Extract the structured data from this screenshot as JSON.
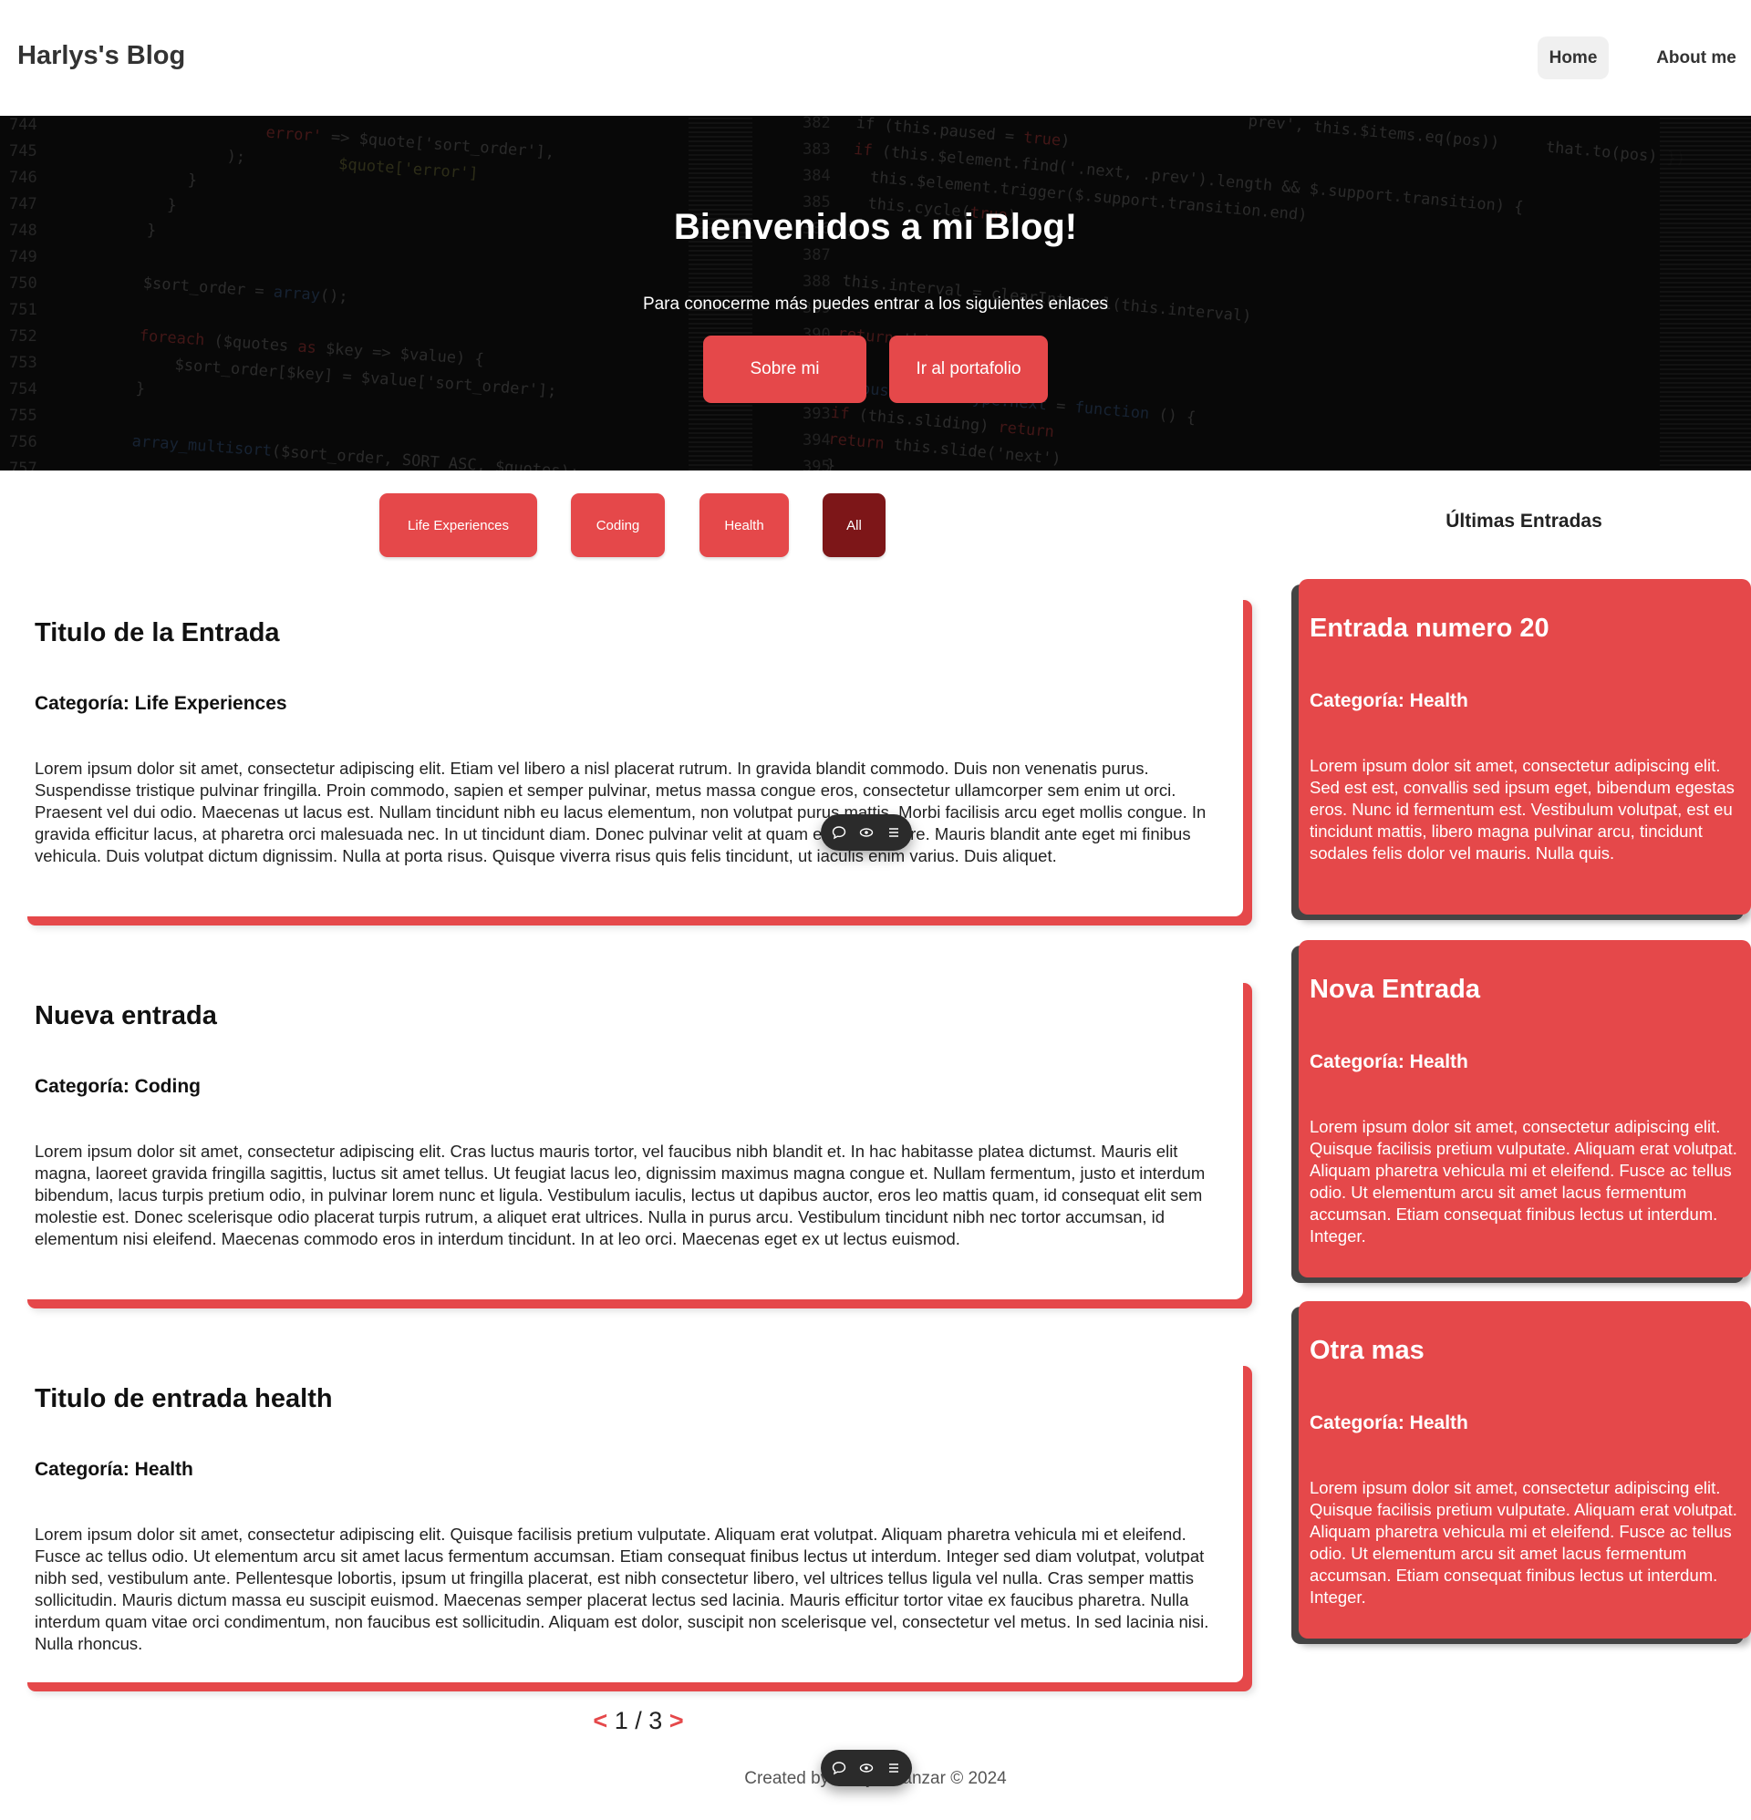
{
  "header": {
    "brand": "Harlys's Blog",
    "nav": [
      {
        "label": "Home",
        "active": true
      },
      {
        "label": "About me",
        "active": false
      }
    ]
  },
  "hero": {
    "title": "Bienvenidos a mi Blog!",
    "subtitle": "Para conocerme más puedes entrar a los siguientes enlaces",
    "buttons": [
      {
        "label": "Sobre mi"
      },
      {
        "label": "Ir al portafolio"
      }
    ]
  },
  "filters": [
    {
      "label": "Life Experiences",
      "active": false
    },
    {
      "label": "Coding",
      "active": false
    },
    {
      "label": "Health",
      "active": false
    },
    {
      "label": "All",
      "active": true
    }
  ],
  "posts": [
    {
      "title": "Titulo de la Entrada",
      "category": "Categoría: Life Experiences",
      "body": "Lorem ipsum dolor sit amet, consectetur adipiscing elit. Etiam vel libero a nisl placerat rutrum. In gravida blandit commodo. Duis non venenatis purus. Suspendisse tristique pulvinar fringilla. Proin commodo, sapien et semper pulvinar, metus massa congue eros, consectetur ullamcorper sem enim ut orci. Praesent vel dui odio. Maecenas ut lacus est. Nullam tincidunt nibh eu lacus elementum, non volutpat purus mattis. Morbi facilisis arcu eget mollis congue. In gravida efficitur lacus, at pharetra orci malesuada nec. In ut tincidunt diam. Donec pulvinar velit at quam eleifend ornare. Mauris blandit ante eget mi finibus vehicula. Duis volutpat dictum dignissim. Nulla at porta risus. Quisque viverra risus quis felis tincidunt, ut iaculis enim varius. Duis aliquet."
    },
    {
      "title": "Nueva entrada",
      "category": "Categoría: Coding",
      "body": "Lorem ipsum dolor sit amet, consectetur adipiscing elit. Cras luctus mauris tortor, vel faucibus nibh blandit et. In hac habitasse platea dictumst. Mauris elit magna, laoreet gravida fringilla sagittis, luctus sit amet tellus. Ut feugiat lacus leo, dignissim maximus magna congue et. Nullam fermentum, justo et interdum bibendum, lacus turpis pretium odio, in pulvinar lorem nunc et ligula. Vestibulum iaculis, lectus ut dapibus auctor, eros leo mattis quam, id consequat elit sem molestie est. Donec scelerisque odio placerat turpis rutrum, a aliquet erat ultrices. Nulla in purus arcu. Vestibulum tincidunt nibh nec tortor accumsan, id elementum nisi eleifend. Maecenas commodo eros in interdum tincidunt. In at leo orci. Maecenas eget ex ut lectus euismod."
    },
    {
      "title": "Titulo de entrada health",
      "category": "Categoría: Health",
      "body": "Lorem ipsum dolor sit amet, consectetur adipiscing elit. Quisque facilisis pretium vulputate. Aliquam erat volutpat. Aliquam pharetra vehicula mi et eleifend. Fusce ac tellus odio. Ut elementum arcu sit amet lacus fermentum accumsan. Etiam consequat finibus lectus ut interdum. Integer sed diam volutpat, volutpat nibh sed, vestibulum ante. Pellentesque lobortis, ipsum ut fringilla placerat, est nibh consectetur libero, vel ultrices tellus ligula vel nulla. Cras semper mattis sollicitudin. Mauris dictum massa eu suscipit euismod. Maecenas semper placerat lectus sed lacinia. Mauris efficitur tortor vitae ex faucibus pharetra. Nulla interdum quam vitae orci condimentum, non faucibus est sollicitudin. Aliquam est dolor, suscipit non scelerisque vel, consectetur vel metus. In sed lacinia nisi. Nulla rhoncus."
    }
  ],
  "sidebar": {
    "heading": "Últimas Entradas",
    "cards": [
      {
        "title": "Entrada numero 20",
        "category": "Categoría: Health",
        "body": "Lorem ipsum dolor sit amet, consectetur adipiscing elit. Sed est est, convallis sed ipsum eget, bibendum egestas eros. Nunc id fermentum est. Vestibulum volutpat, est eu tincidunt mattis, libero magna pulvinar arcu, tincidunt sodales felis dolor vel mauris. Nulla quis."
      },
      {
        "title": "Nova Entrada",
        "category": "Categoría: Health",
        "body": "Lorem ipsum dolor sit amet, consectetur adipiscing elit. Quisque facilisis pretium vulputate. Aliquam erat volutpat. Aliquam pharetra vehicula mi et eleifend. Fusce ac tellus odio. Ut elementum arcu sit amet lacus fermentum accumsan. Etiam consequat finibus lectus ut interdum. Integer."
      },
      {
        "title": "Otra mas",
        "category": "Categoría: Health",
        "body": "Lorem ipsum dolor sit amet, consectetur adipiscing elit. Quisque facilisis pretium vulputate. Aliquam erat volutpat. Aliquam pharetra vehicula mi et eleifend. Fusce ac tellus odio. Ut elementum arcu sit amet lacus fermentum accumsan. Etiam consequat finibus lectus ut interdum. Integer."
      }
    ]
  },
  "pagination": {
    "prev": "<",
    "current": "1",
    "separator": "/",
    "total": "3",
    "next": ">"
  },
  "footer": {
    "text": "Created by Harlys Manzar © 2024"
  },
  "floating_toolbar": {
    "icons": [
      "comment-icon",
      "eye-icon",
      "list-icon"
    ]
  },
  "colors": {
    "accent": "#e5484a",
    "accent_dark": "#7d1618",
    "hero_bg": "#0b0b0b"
  }
}
